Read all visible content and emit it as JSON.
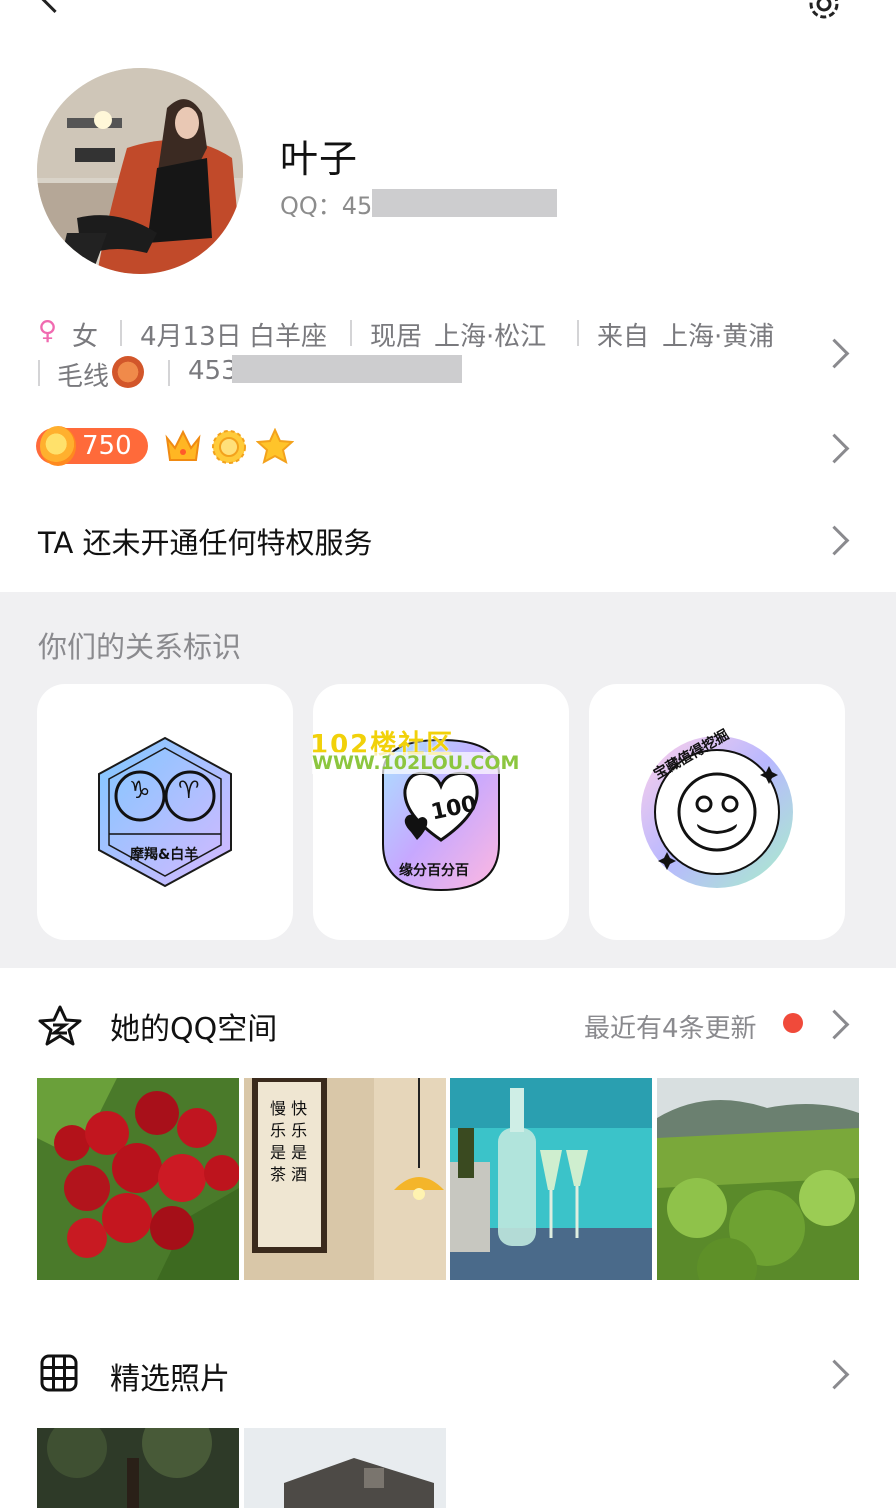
{
  "topbar": {
    "back_icon": "back-arrow-icon",
    "settings_icon": "gear-icon"
  },
  "profile": {
    "nickname": "叶子",
    "qq_label": "QQ：",
    "qq_number_visible": "45"
  },
  "info": {
    "gender_symbol": "♀",
    "gender": "女",
    "birthday": "4月13日",
    "zodiac": "白羊座",
    "residence_label": "现居",
    "residence": "上海·松江",
    "hometown_label": "来自",
    "hometown": "上海·黄浦",
    "hobby": "毛线",
    "email_visible": "453"
  },
  "badges": {
    "level": "750"
  },
  "privilege": {
    "text": "TA 还未开通任何特权服务"
  },
  "relation": {
    "title": "你们的关系标识",
    "cards": [
      {
        "label": "摩羯&白羊",
        "glyph_left": "♑",
        "glyph_right": "♈"
      },
      {
        "label": "缘分百分百",
        "number": "100"
      },
      {
        "label": "宝藏值得挖掘"
      }
    ]
  },
  "watermark": {
    "line1": "102楼社区",
    "line2": "WWW.102LOU.COM"
  },
  "qzone": {
    "title": "她的QQ空间",
    "update_text": "最近有4条更新",
    "thumb2_text": "慢 快 乐 乐 是 是 茶 酒"
  },
  "photos": {
    "title": "精选照片"
  },
  "colors": {
    "accent_orange": "#ff6a3a",
    "dot_red": "#f04a3a",
    "section_bg": "#f0f0f2"
  }
}
